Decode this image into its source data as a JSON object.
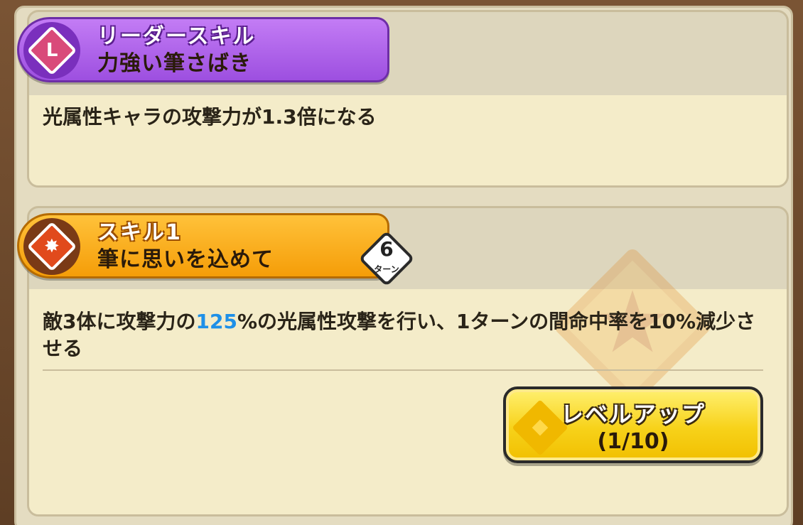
{
  "leader_skill": {
    "header": "リーダースキル",
    "name": "力強い筆さばき",
    "description": "光属性キャラの攻撃力が1.3倍になる",
    "icon": "leader-scroll-icon",
    "color": "#a959e8"
  },
  "skill1": {
    "header": "スキル1",
    "name": "筆に思いを込めて",
    "turns": "6",
    "turn_unit": "ターン",
    "icon": "skill-burst-icon",
    "color": "#f8a816",
    "description_before": "敵3体に攻撃力の",
    "description_highlight": "125",
    "description_after": "%の光属性攻撃を行い、1ターンの間命中率を10%減少させる",
    "highlight_color": "#1e90e8"
  },
  "level_up": {
    "label": "レベルアップ",
    "count": "(1/10)"
  }
}
